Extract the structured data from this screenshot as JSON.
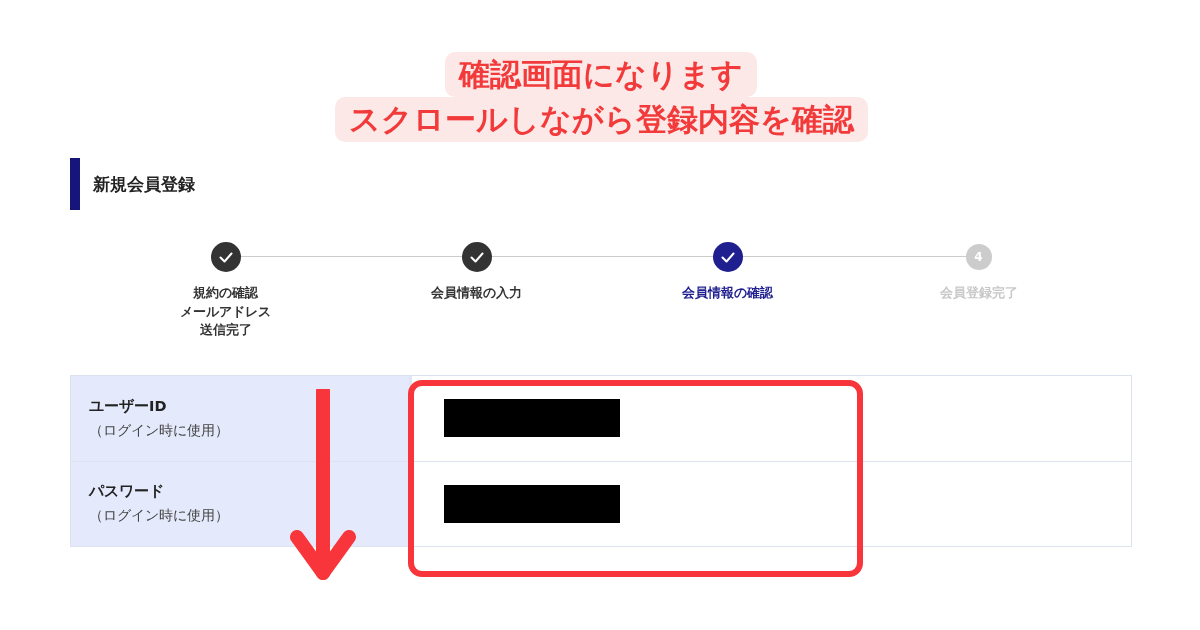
{
  "callout": {
    "lines": [
      "確認画面になります",
      "スクロールしながら登録内容を確認"
    ]
  },
  "heading": "新規会員登録",
  "steps": [
    {
      "label_lines": [
        "規約の確認",
        "メールアドレス",
        "送信完了"
      ],
      "kind": "done"
    },
    {
      "label_lines": [
        "会員情報の入力"
      ],
      "kind": "done"
    },
    {
      "label_lines": [
        "会員情報の確認"
      ],
      "kind": "current"
    },
    {
      "label_lines": [
        "会員登録完了"
      ],
      "kind": "pending",
      "number": "4"
    }
  ],
  "fields": [
    {
      "label": "ユーザーID",
      "note": "（ログイン時に使用）",
      "redacted": true
    },
    {
      "label": "パスワード",
      "note": "（ログイン時に使用）",
      "redacted": true
    }
  ]
}
